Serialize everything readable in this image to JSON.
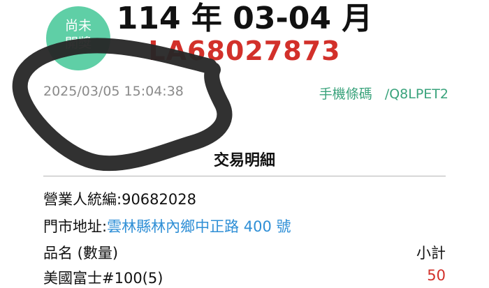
{
  "badge": {
    "line1": "尚未",
    "line2": "開獎"
  },
  "invoice": {
    "period": "114 年 03-04 月",
    "number": "LA68027873",
    "datetime": "2025/03/05 15:04:38",
    "carrier_label": "手機條碼",
    "carrier_code": "/Q8LPET2"
  },
  "details": {
    "title": "交易明細",
    "seller_label": "營業人統編:",
    "seller_id": "90682028",
    "address_label": "門市地址:",
    "address": "雲林縣林內鄉中正路 400 號",
    "col_item": "品名 (數量)",
    "col_subtotal": "小計",
    "items": [
      {
        "name": "美國富士#100(5)",
        "subtotal": "50"
      }
    ]
  },
  "colors": {
    "badge": "#5fcfa6",
    "invoice_number": "#d2302a",
    "carrier": "#3aa37c",
    "address_link": "#2f8fd6",
    "scribble": "#262626"
  }
}
